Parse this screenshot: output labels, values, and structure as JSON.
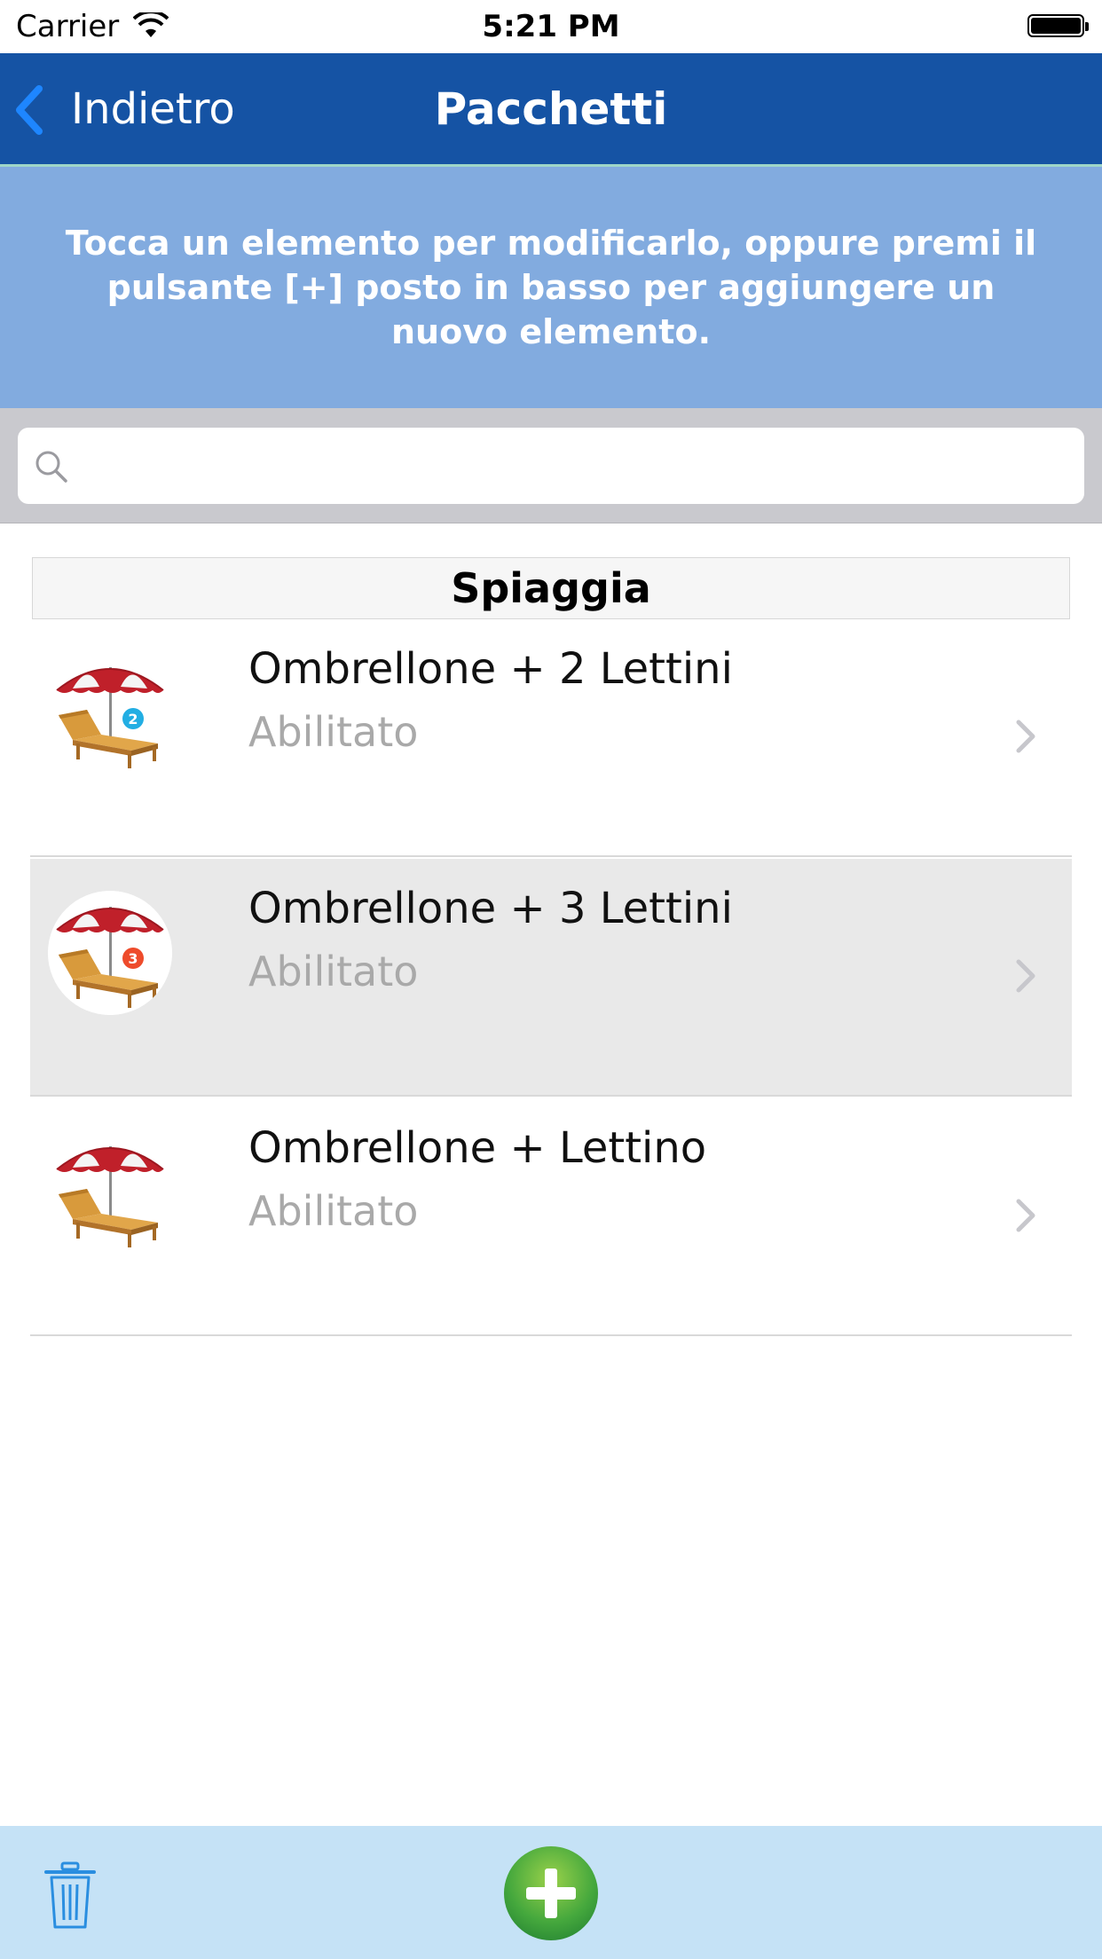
{
  "status_bar": {
    "carrier": "Carrier",
    "time": "5:21 PM"
  },
  "nav": {
    "back_label": "Indietro",
    "title": "Pacchetti"
  },
  "banner": {
    "text": "Tocca un elemento per modificarlo, oppure premi il pulsante [+] posto in basso per aggiungere un nuovo elemento."
  },
  "search": {
    "placeholder": "",
    "value": ""
  },
  "list": {
    "section_title": "Spiaggia",
    "items": [
      {
        "title": "Ombrellone + 2 Lettini",
        "subtitle": "Abilitato",
        "icon": "umbrella-2-loungers-icon",
        "badge": "2",
        "badge_color": "#22aee3"
      },
      {
        "title": "Ombrellone + 3 Lettini",
        "subtitle": "Abilitato",
        "icon": "umbrella-3-loungers-icon",
        "badge": "3",
        "badge_color": "#ee4b2b"
      },
      {
        "title": "Ombrellone + Lettino",
        "subtitle": "Abilitato",
        "icon": "umbrella-lounger-icon"
      }
    ]
  },
  "toolbar": {
    "delete_icon": "trash-icon",
    "add_icon": "add-icon"
  },
  "colors": {
    "nav": "#1553a4",
    "banner": "#82abdf",
    "toolbar": "#c5e2f6",
    "add": "#52b34a",
    "selected_row": "#e9e9e9"
  }
}
